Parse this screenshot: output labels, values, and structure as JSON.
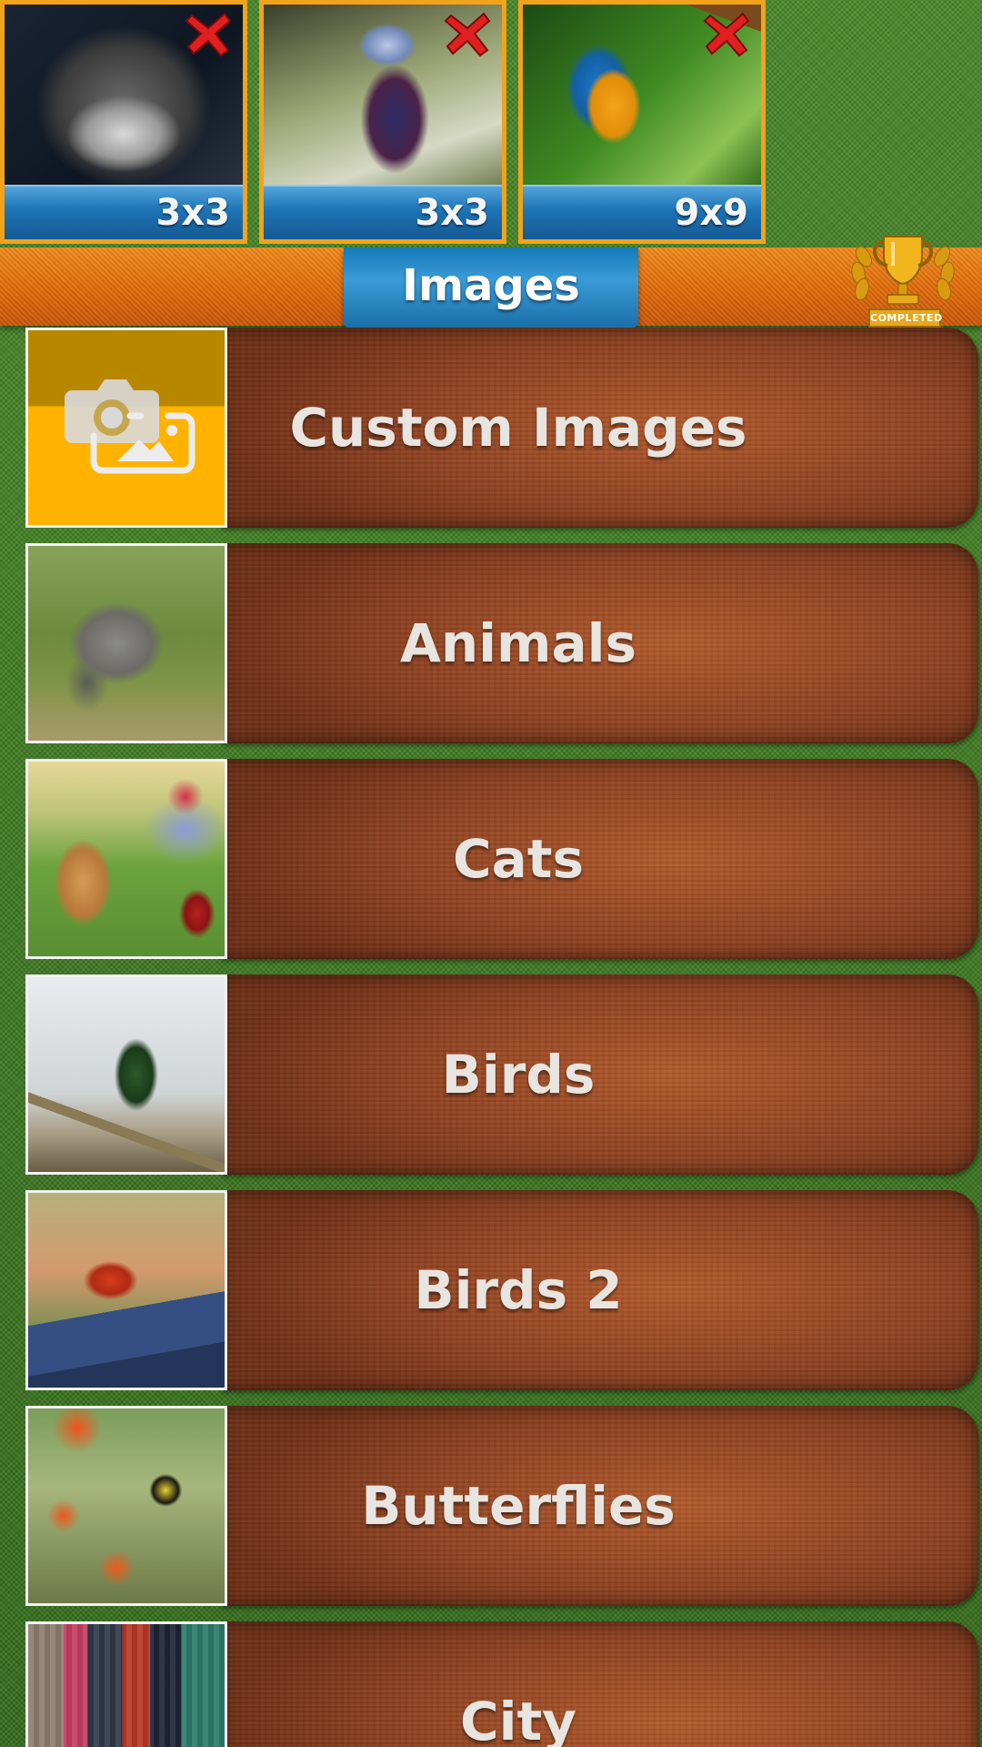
{
  "colors": {
    "accent_orange": "#f3a21b",
    "header_blue": "#1e74b6",
    "plank_brown": "#8f4120",
    "felt_green": "#3f7d22",
    "delete_red": "#e21f1f",
    "custom_yellow": "#ffb300"
  },
  "recent_puzzles": [
    {
      "size": "3x3",
      "image_icon": "kitten-photo",
      "delete_icon": "close-icon"
    },
    {
      "size": "3x3",
      "image_icon": "pigeon-photo",
      "delete_icon": "close-icon"
    },
    {
      "size": "9x9",
      "image_icon": "parrot-photo",
      "delete_icon": "close-icon"
    }
  ],
  "header": {
    "title": "Images",
    "trophy_caption": "COMPLETED",
    "trophy_icon": "trophy-icon"
  },
  "categories": [
    {
      "label": "Custom Images",
      "thumb_icon": "camera-gallery-icon"
    },
    {
      "label": "Animals",
      "thumb_icon": "rhino-photo"
    },
    {
      "label": "Cats",
      "thumb_icon": "cat-photo"
    },
    {
      "label": "Birds",
      "thumb_icon": "hummingbird-photo"
    },
    {
      "label": "Birds 2",
      "thumb_icon": "cardinal-photo"
    },
    {
      "label": "Butterflies",
      "thumb_icon": "butterfly-photo"
    },
    {
      "label": "City",
      "thumb_icon": "city-photo"
    }
  ]
}
